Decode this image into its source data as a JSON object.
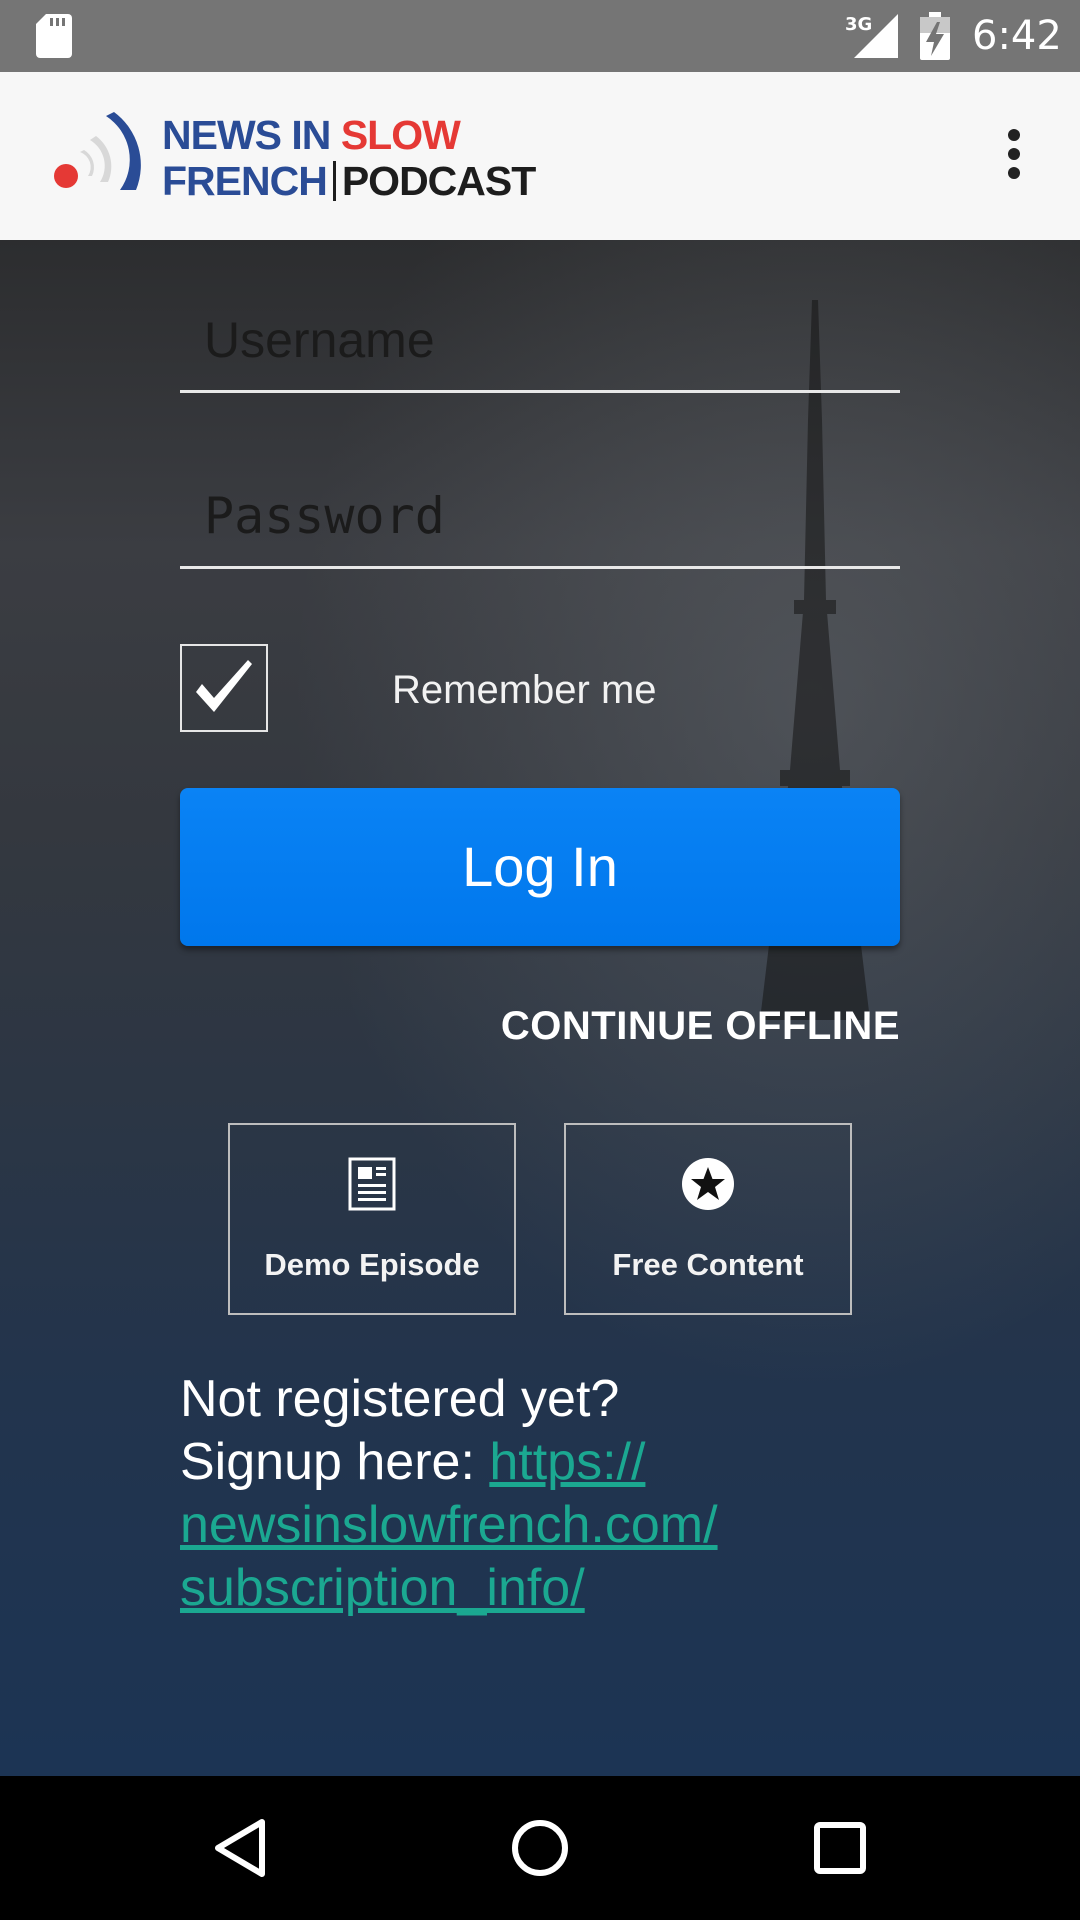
{
  "status_bar": {
    "network": "3G",
    "time": "6:42",
    "icons": [
      "sd-card-icon",
      "signal-icon",
      "battery-charging-icon"
    ]
  },
  "app_bar": {
    "logo_line1_a": "NEWS IN",
    "logo_line1_b": "SLOW",
    "logo_line2_a": "FRENCH",
    "logo_line2_b": "PODCAST",
    "menu_icon": "more-vert-icon"
  },
  "login": {
    "username_placeholder": "Username",
    "username_value": "",
    "password_placeholder": "Password",
    "password_value": "",
    "remember_label": "Remember me",
    "remember_checked": true,
    "login_label": "Log In",
    "continue_offline_label": "CONTINUE OFFLINE"
  },
  "quick_links": [
    {
      "label": "Demo Episode",
      "icon": "article-icon"
    },
    {
      "label": "Free Content",
      "icon": "star-circle-icon"
    }
  ],
  "signup": {
    "line1": "Not registered yet?",
    "prefix": "Signup here: ",
    "link_part1": "https://",
    "link_part2": "newsinslowfrench.com/",
    "link_part3": "subscription_info/"
  },
  "nav_bar": {
    "icons": [
      "back-icon",
      "home-icon",
      "recents-icon"
    ]
  },
  "colors": {
    "accent_blue": "#0a83f5",
    "link_teal": "#1ba891",
    "logo_blue": "#2a4c96",
    "logo_red": "#e53935"
  }
}
